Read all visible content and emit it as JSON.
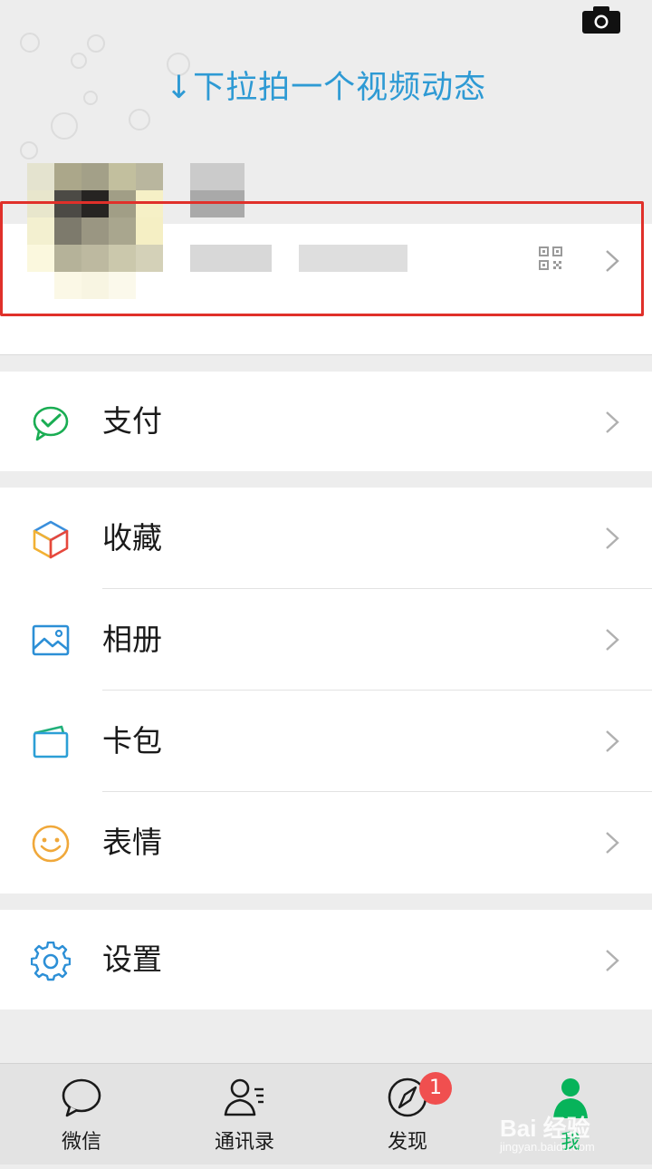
{
  "header": {
    "pull_hint": "↓下拉拍一个视频动态"
  },
  "profile": {
    "icons": {
      "camera": "camera-icon",
      "qr": "qr-code-icon",
      "chevron": "chevron-right-icon"
    },
    "highlight_color": "#e0302a"
  },
  "menu": {
    "pay": {
      "label": "支付",
      "icon": "wechat-pay-icon",
      "color": "#1aad53"
    },
    "favorites": {
      "label": "收藏",
      "icon": "favorites-cube-icon"
    },
    "album": {
      "label": "相册",
      "icon": "album-picture-icon",
      "color": "#2c8fd6"
    },
    "cards": {
      "label": "卡包",
      "icon": "card-wallet-icon",
      "color": "#2c9fd6"
    },
    "stickers": {
      "label": "表情",
      "icon": "smiley-icon",
      "color": "#f0a83a"
    },
    "settings": {
      "label": "设置",
      "icon": "gear-icon",
      "color": "#2c8fd6"
    }
  },
  "tabbar": {
    "tabs": [
      {
        "label": "微信",
        "icon": "chat-bubble-icon"
      },
      {
        "label": "通讯录",
        "icon": "contacts-icon"
      },
      {
        "label": "发现",
        "icon": "compass-icon"
      },
      {
        "label": "我",
        "icon": "me-person-icon"
      }
    ],
    "discover_badge": "1",
    "active_color": "#07b35a"
  },
  "watermark": {
    "text": "Bai 经验",
    "sub": "jingyan.baidu.com"
  }
}
